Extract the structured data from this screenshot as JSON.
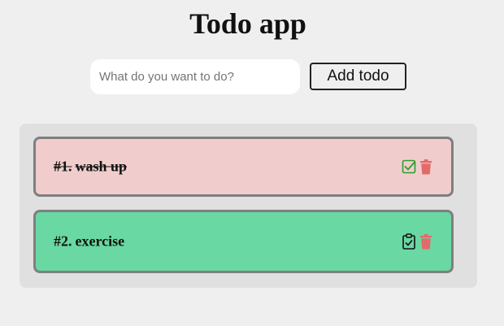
{
  "app": {
    "title": "Todo app"
  },
  "form": {
    "placeholder": "What do you want to do?",
    "value": "",
    "add_label": "Add todo"
  },
  "todos": [
    {
      "number": "#1.",
      "text": "wash up",
      "completed": true,
      "status_icon": "check-square-icon",
      "delete_icon": "trash-icon",
      "color": "#f0cdcc"
    },
    {
      "number": "#2.",
      "text": "exercise",
      "completed": false,
      "status_icon": "clipboard-check-icon",
      "delete_icon": "trash-icon",
      "color": "#69d8a2"
    }
  ],
  "colors": {
    "complete_icon": "#2e9d2e",
    "delete_icon": "#e36a6a",
    "border": "#7f7f7f"
  }
}
